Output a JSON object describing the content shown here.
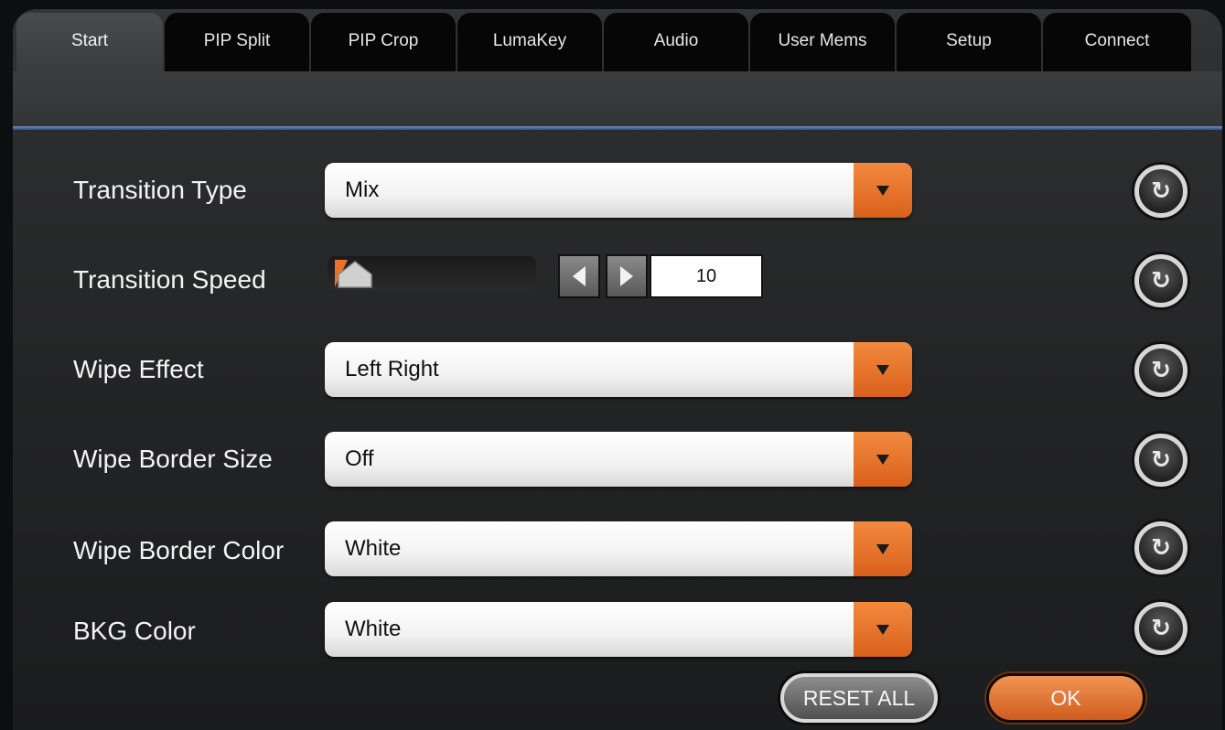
{
  "tabs": [
    {
      "label": "Start",
      "active": true
    },
    {
      "label": "PIP Split",
      "active": false
    },
    {
      "label": "PIP Crop",
      "active": false
    },
    {
      "label": "LumaKey",
      "active": false
    },
    {
      "label": "Audio",
      "active": false
    },
    {
      "label": "User Mems",
      "active": false
    },
    {
      "label": "Setup",
      "active": false
    },
    {
      "label": "Connect",
      "active": false
    }
  ],
  "settings": {
    "transition_type": {
      "label": "Transition Type",
      "value": "Mix"
    },
    "transition_speed": {
      "label": "Transition Speed",
      "value": "10",
      "slider_fraction": 0.0
    },
    "wipe_effect": {
      "label": "Wipe Effect",
      "value": "Left Right"
    },
    "wipe_border_size": {
      "label": "Wipe Border Size",
      "value": "Off"
    },
    "wipe_border_color": {
      "label": "Wipe Border Color",
      "value": "White"
    },
    "bkg_color": {
      "label": "BKG Color",
      "value": "White"
    }
  },
  "buttons": {
    "reset_all": "RESET ALL",
    "ok": "OK"
  },
  "icons": {
    "dropdown": "triangle-down",
    "reset": "circular-reset",
    "step_left": "triangle-left",
    "step_right": "triangle-right"
  },
  "colors": {
    "accent_orange": "#e8722c",
    "tab_bar": "#060606",
    "header_line_blue": "#4a6aa8"
  }
}
